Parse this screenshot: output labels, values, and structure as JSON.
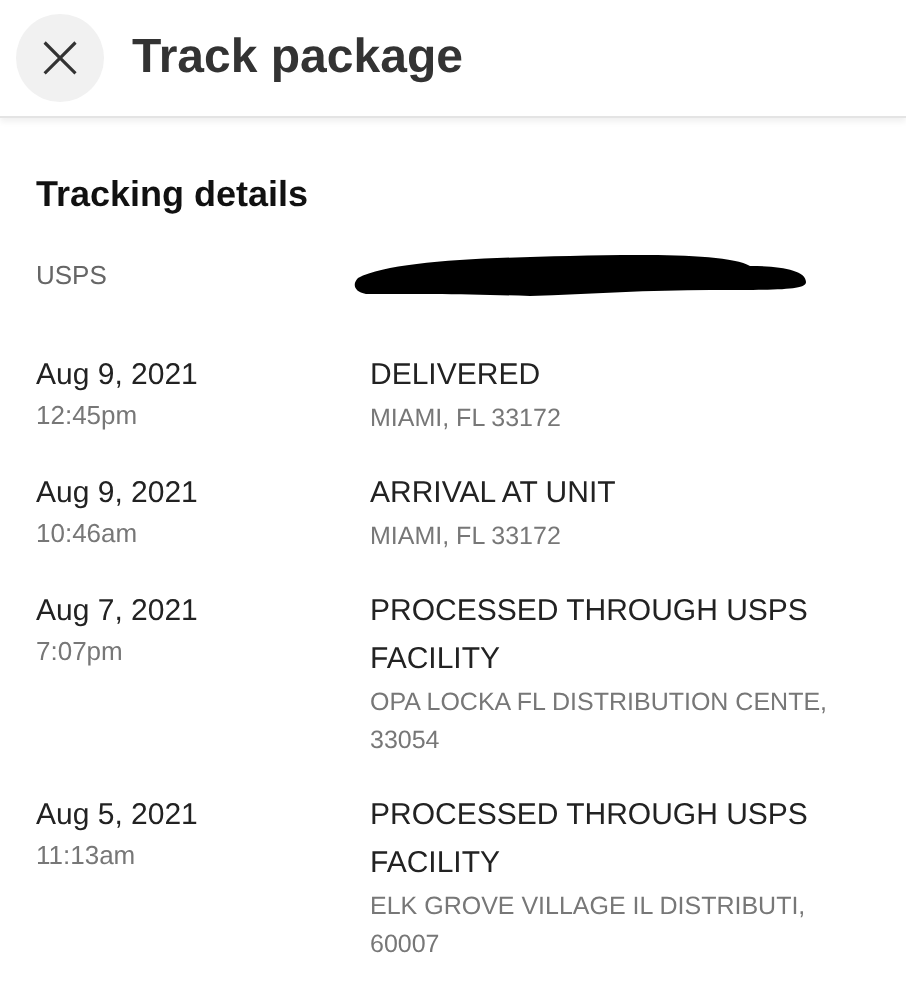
{
  "header": {
    "close_icon": "×",
    "title": "Track package"
  },
  "section": {
    "title": "Tracking details",
    "carrier": "USPS"
  },
  "events": [
    {
      "date": "Aug 9, 2021",
      "time": "12:45pm",
      "status": "DELIVERED",
      "location": "MIAMI, FL 33172"
    },
    {
      "date": "Aug 9, 2021",
      "time": "10:46am",
      "status": "ARRIVAL AT UNIT",
      "location": "MIAMI, FL 33172"
    },
    {
      "date": "Aug 7, 2021",
      "time": "7:07pm",
      "status": "PROCESSED THROUGH USPS FACILITY",
      "location": "OPA LOCKA FL DISTRIBUTION CENTE, 33054"
    },
    {
      "date": "Aug 5, 2021",
      "time": "11:13am",
      "status": "PROCESSED THROUGH USPS FACILITY",
      "location": "ELK GROVE VILLAGE IL DISTRIBUTI, 60007"
    }
  ]
}
